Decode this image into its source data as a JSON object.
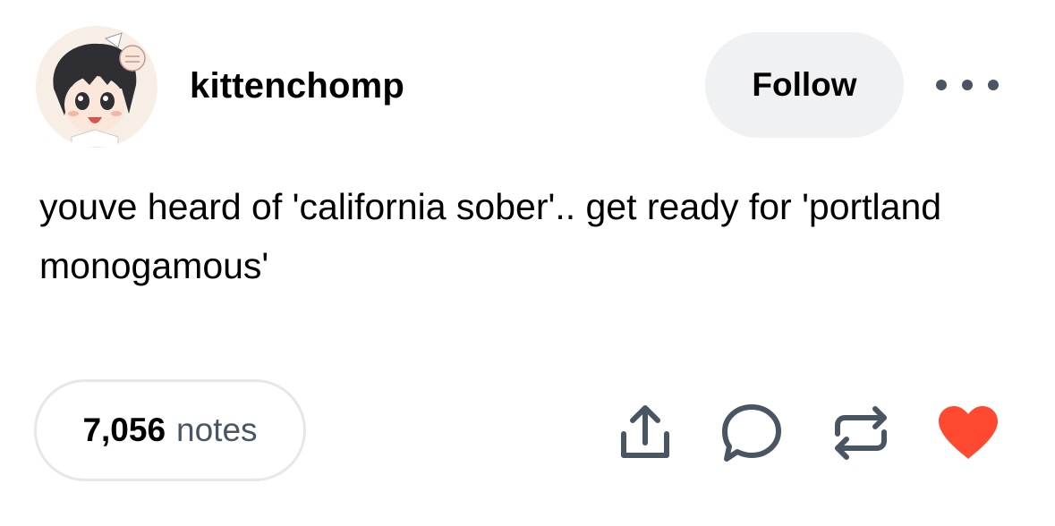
{
  "post": {
    "username": "kittenchomp",
    "follow_label": "Follow",
    "body": "youve heard of 'california sober'.. get ready for 'portland monogamous'",
    "notes_count": "7,056",
    "notes_label": "notes"
  },
  "icons": {
    "more": "more-options-icon",
    "share": "share-icon",
    "reply": "reply-icon",
    "reblog": "reblog-icon",
    "like": "heart-icon"
  },
  "colors": {
    "icon_gray": "#4a5564",
    "like_red": "#ff4930",
    "follow_bg": "#f0f1f3",
    "pill_border": "#e6e7ea"
  }
}
